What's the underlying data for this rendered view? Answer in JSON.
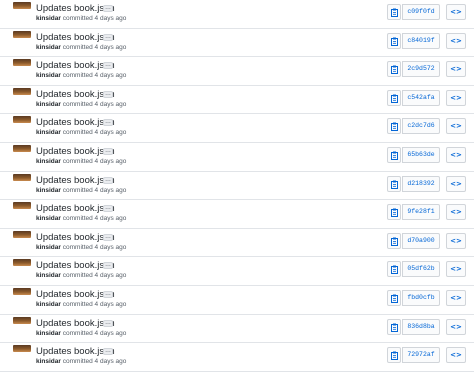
{
  "commits": [
    {
      "title": "Updates book.json",
      "author": "kinsidar",
      "action": "committed",
      "time": "4 days ago",
      "sha": "c09f0fd",
      "ellipsis": "…",
      "browse": "<>"
    },
    {
      "title": "Updates book.json",
      "author": "kinsidar",
      "action": "committed",
      "time": "4 days ago",
      "sha": "c84019f",
      "ellipsis": "…",
      "browse": "<>"
    },
    {
      "title": "Updates book.json",
      "author": "kinsidar",
      "action": "committed",
      "time": "4 days ago",
      "sha": "2c9d572",
      "ellipsis": "…",
      "browse": "<>"
    },
    {
      "title": "Updates book.json",
      "author": "kinsidar",
      "action": "committed",
      "time": "4 days ago",
      "sha": "c542afa",
      "ellipsis": "…",
      "browse": "<>"
    },
    {
      "title": "Updates book.json",
      "author": "kinsidar",
      "action": "committed",
      "time": "4 days ago",
      "sha": "c2dc7d6",
      "ellipsis": "…",
      "browse": "<>"
    },
    {
      "title": "Updates book.json",
      "author": "kinsidar",
      "action": "committed",
      "time": "4 days ago",
      "sha": "65b63de",
      "ellipsis": "…",
      "browse": "<>"
    },
    {
      "title": "Updates book.json",
      "author": "kinsidar",
      "action": "committed",
      "time": "4 days ago",
      "sha": "d218392",
      "ellipsis": "…",
      "browse": "<>"
    },
    {
      "title": "Updates book.json",
      "author": "kinsidar",
      "action": "committed",
      "time": "4 days ago",
      "sha": "9fe28f1",
      "ellipsis": "…",
      "browse": "<>"
    },
    {
      "title": "Updates book.json",
      "author": "kinsidar",
      "action": "committed",
      "time": "4 days ago",
      "sha": "d70a900",
      "ellipsis": "…",
      "browse": "<>"
    },
    {
      "title": "Updates book.json",
      "author": "kinsidar",
      "action": "committed",
      "time": "4 days ago",
      "sha": "05df62b",
      "ellipsis": "…",
      "browse": "<>"
    },
    {
      "title": "Updates book.json",
      "author": "kinsidar",
      "action": "committed",
      "time": "4 days ago",
      "sha": "fbd0cfb",
      "ellipsis": "…",
      "browse": "<>"
    },
    {
      "title": "Updates book.json",
      "author": "kinsidar",
      "action": "committed",
      "time": "4 days ago",
      "sha": "836d8ba",
      "ellipsis": "…",
      "browse": "<>"
    },
    {
      "title": "Updates book.json",
      "author": "kinsidar",
      "action": "committed",
      "time": "4 days ago",
      "sha": "72972af",
      "ellipsis": "…",
      "browse": "<>"
    }
  ],
  "colors": {
    "link": "#0366d6",
    "border": "#e1e4e8",
    "muted": "#586069"
  },
  "icons": {
    "copy": "clipboard-icon",
    "browse": "code-icon",
    "avatar": "avatar"
  }
}
